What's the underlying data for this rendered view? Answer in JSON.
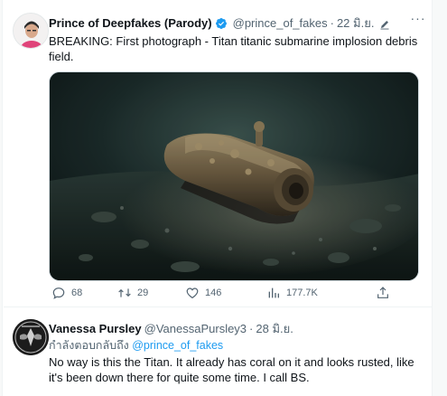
{
  "main_tweet": {
    "author_name": "Prince of Deepfakes (Parody)",
    "author_handle": "@prince_of_fakes",
    "separator": "·",
    "timestamp": "22 มิ.ย.",
    "text": "BREAKING: First photograph - Titan titanic submarine implosion debris field.",
    "stats": {
      "replies": "68",
      "retweets": "29",
      "likes": "146",
      "views": "177.7K"
    },
    "more_label": "···"
  },
  "reply_tweet": {
    "author_name": "Vanessa Pursley",
    "author_handle": "@VanessaPursley3",
    "separator": "·",
    "timestamp": "28 มิ.ย.",
    "replying_to_label": "กำลังตอบกลับถึง",
    "replying_to_handle": "@prince_of_fakes",
    "text": "No way is this the Titan. It already has coral on it and looks rusted, like it's been down there for quite some time. I call BS."
  },
  "colors": {
    "accent": "#1d9bf0",
    "secondary_text": "#536471",
    "primary_text": "#0f1419"
  }
}
